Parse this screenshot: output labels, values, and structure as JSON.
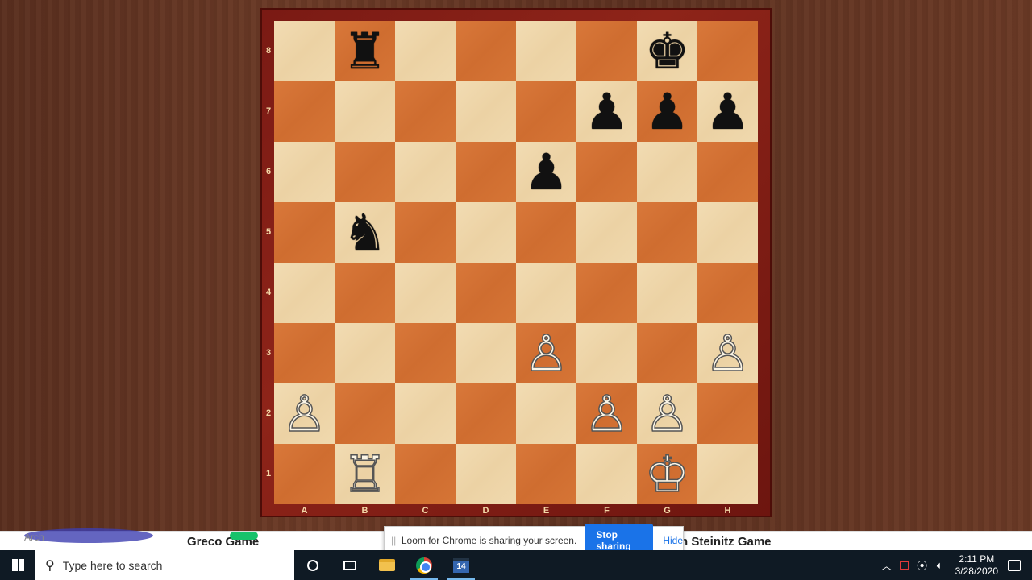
{
  "board": {
    "files": [
      "A",
      "B",
      "C",
      "D",
      "E",
      "F",
      "G",
      "H"
    ],
    "ranks": [
      "8",
      "7",
      "6",
      "5",
      "4",
      "3",
      "2",
      "1"
    ],
    "rows": [
      [
        "",
        "♜",
        "",
        "",
        "",
        "",
        "♚",
        ""
      ],
      [
        "",
        "",
        "",
        "",
        "",
        "♟",
        "♟",
        "♟"
      ],
      [
        "",
        "",
        "",
        "",
        "♟",
        "",
        "",
        ""
      ],
      [
        "",
        "♞",
        "",
        "",
        "",
        "",
        "",
        ""
      ],
      [
        "",
        "",
        "",
        "",
        "",
        "",
        "",
        ""
      ],
      [
        "",
        "",
        "",
        "",
        "♙",
        "",
        "",
        "♙"
      ],
      [
        "♙",
        "",
        "",
        "",
        "",
        "♙",
        "♙",
        ""
      ],
      [
        "",
        "♖",
        "",
        "",
        "",
        "",
        "♔",
        ""
      ]
    ]
  },
  "page_strip": {
    "left_text": "Arch",
    "title_left": "Greco Game",
    "title_right": "n Steinitz Game"
  },
  "loom": {
    "grip": "||",
    "message": "Loom for Chrome is sharing your screen.",
    "stop_label": "Stop sharing",
    "hide_label": "Hide"
  },
  "taskbar": {
    "search_placeholder": "Type here to search",
    "calendar_badge": "14",
    "time": "2:11 PM",
    "date": "3/28/2020"
  }
}
